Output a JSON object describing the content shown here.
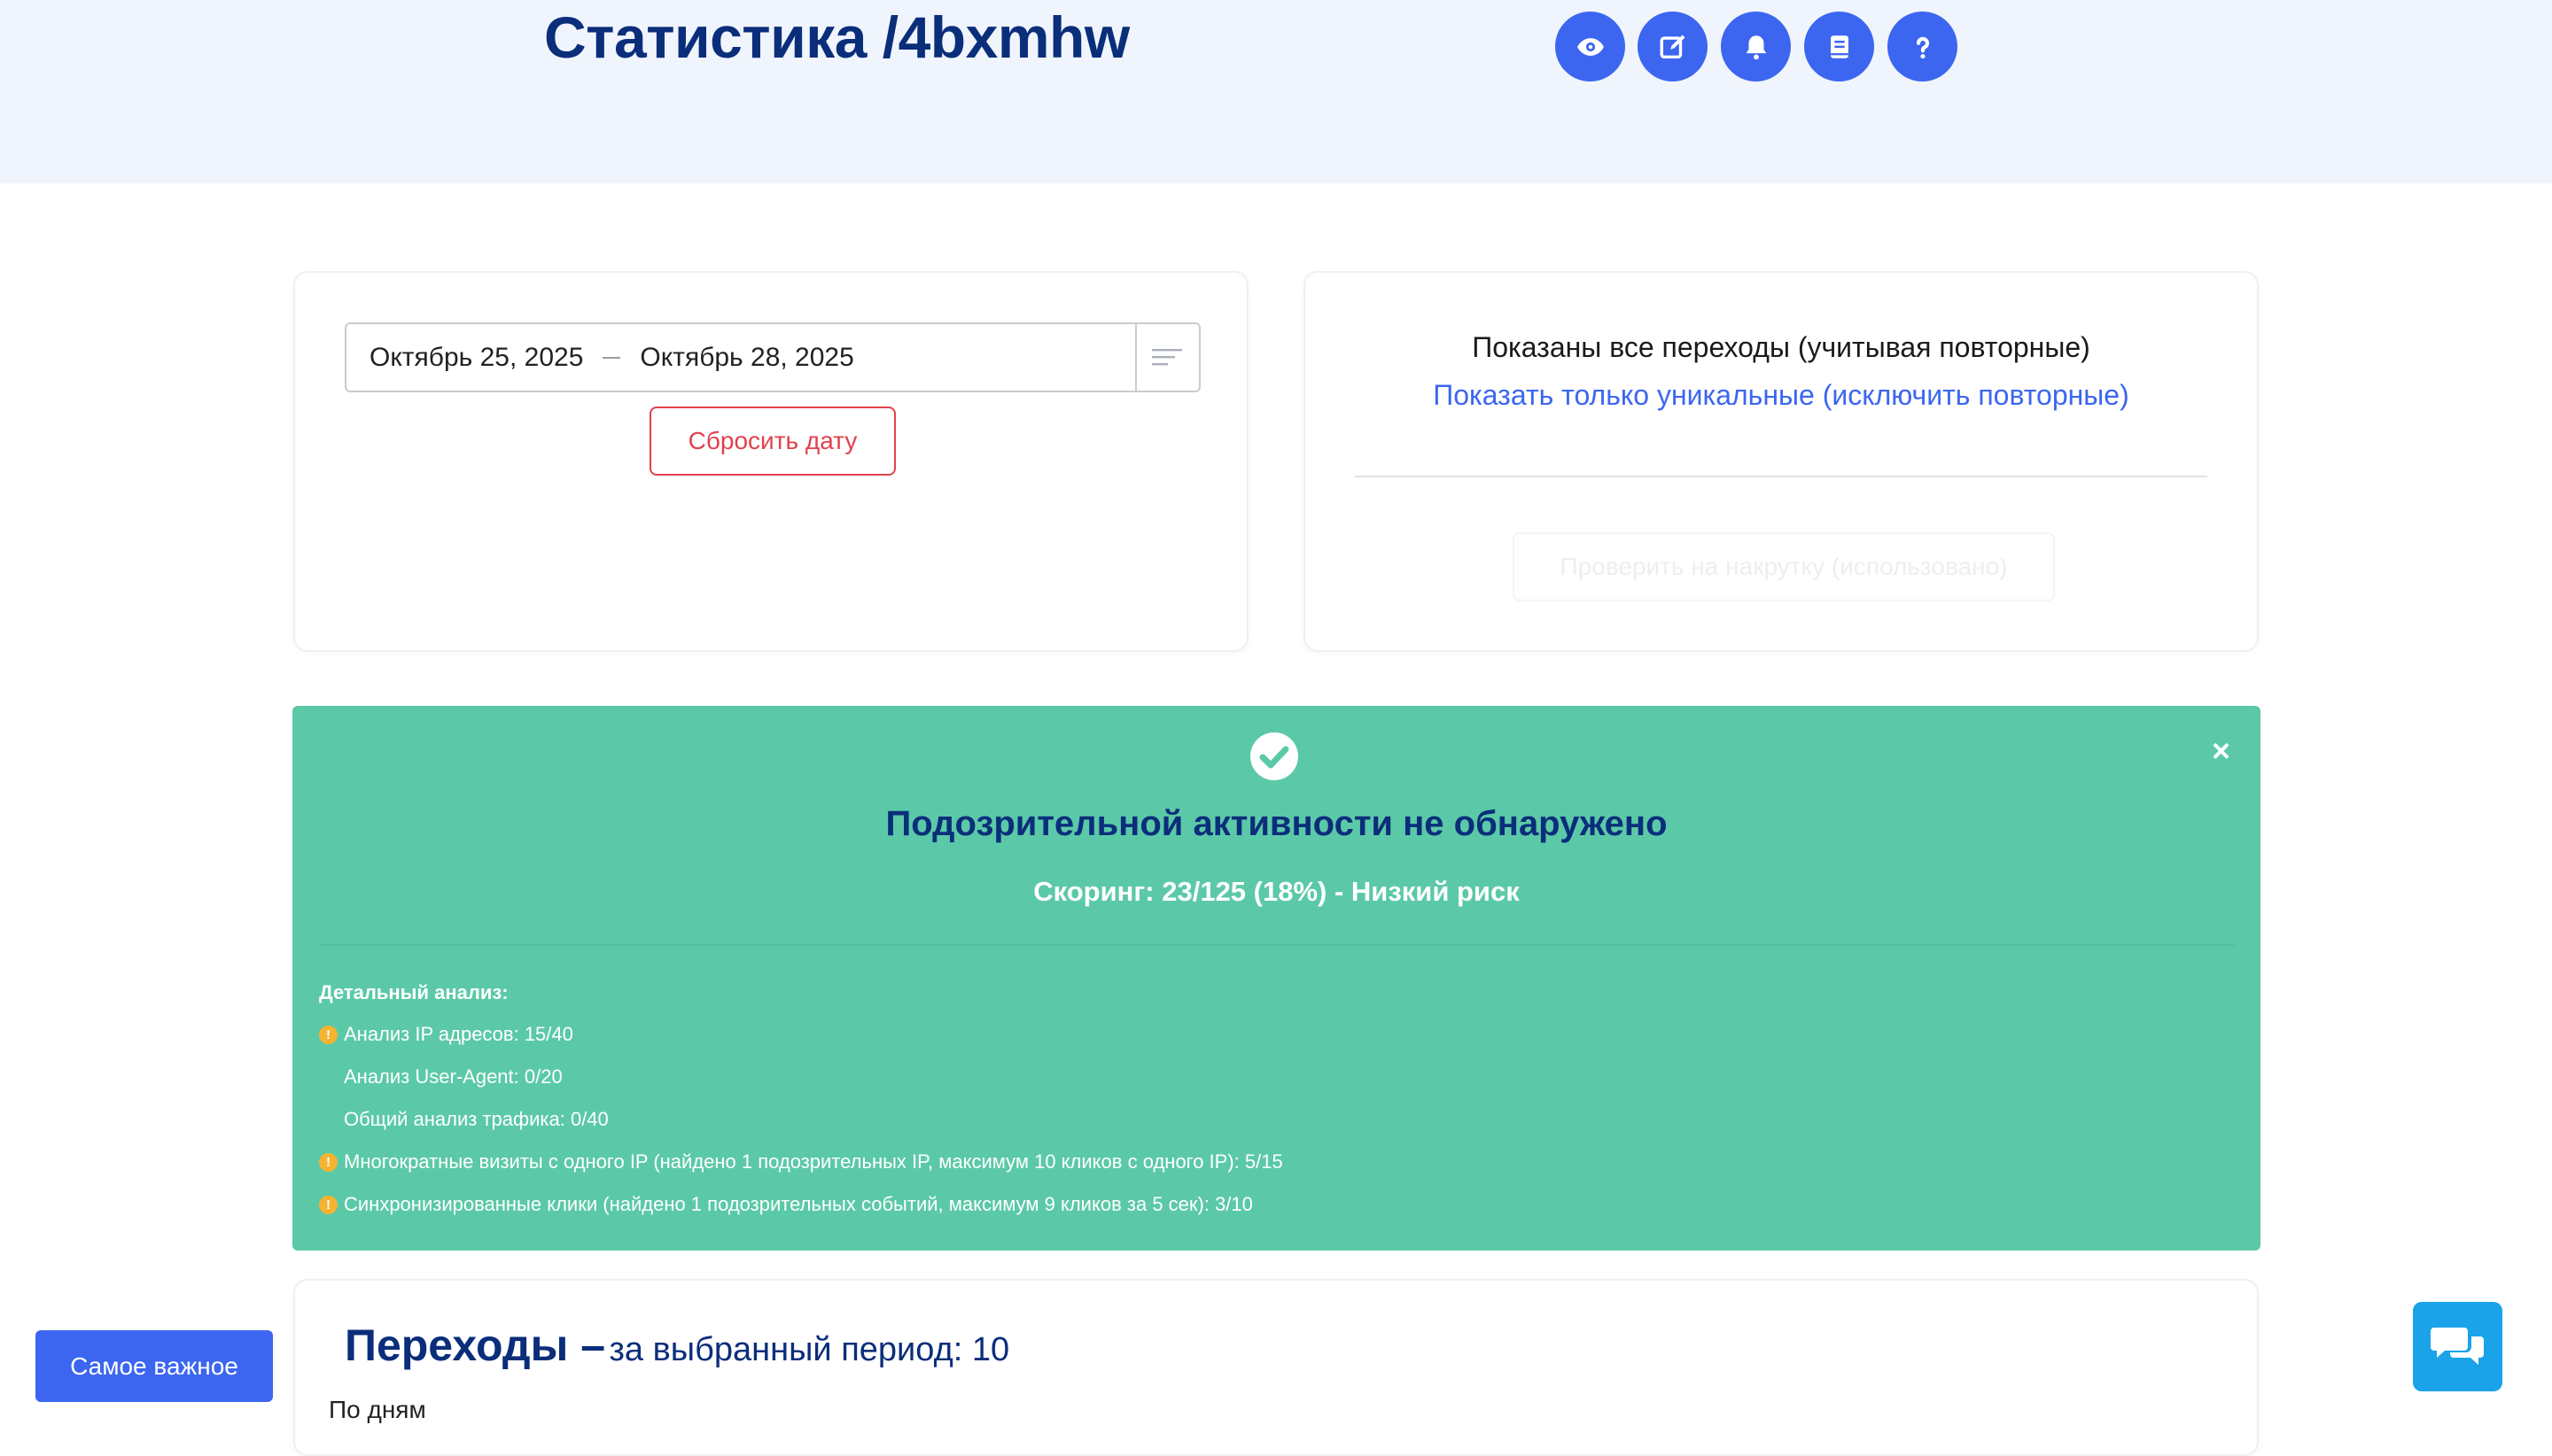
{
  "header": {
    "title": "Статистика /4bxmhw",
    "icons": [
      "eye-icon",
      "edit-icon",
      "bell-icon",
      "book-icon",
      "help-icon"
    ]
  },
  "date_filter": {
    "start": "Октябрь 25, 2025",
    "end": "Октябрь 28, 2025",
    "reset_label": "Сбросить дату"
  },
  "mode_card": {
    "shown_all": "Показаны все переходы (учитывая повторные)",
    "show_unique": "Показать только уникальные (исключить повторные)",
    "check_label": "Проверить на накрутку (использовано)"
  },
  "alert": {
    "title": "Подозрительной активности не обнаружено",
    "score": "Скоринг: 23/125 (18%) - Низкий риск",
    "details_heading": "Детальный анализ:",
    "details": [
      {
        "text": "Анализ IP адресов: 15/40",
        "warn": true
      },
      {
        "text": "Анализ User-Agent: 0/20",
        "warn": false
      },
      {
        "text": "Общий анализ трафика: 0/40",
        "warn": false
      },
      {
        "text": "Многократные визиты с одного IP (найдено 1 подозрительных IP, максимум 10 кликов с одного IP): 5/15",
        "warn": true
      },
      {
        "text": "Синхронизированные клики (найдено 1 подозрительных событий, максимум 9 кликов за 5 сек): 3/10",
        "warn": true
      }
    ],
    "warn_glyph": "!",
    "close_glyph": "×"
  },
  "transitions": {
    "title": "Переходы –",
    "subtitle": "за выбранный период: 10",
    "by_days": "По дням"
  },
  "floating": {
    "important_label": "Самое важное"
  },
  "colors": {
    "primary": "#3c66f0",
    "navy": "#0b2e7b",
    "alert_green": "#5bc9a7",
    "danger": "#e0424d",
    "warning": "#f5b331",
    "chat": "#1aa3e8"
  }
}
